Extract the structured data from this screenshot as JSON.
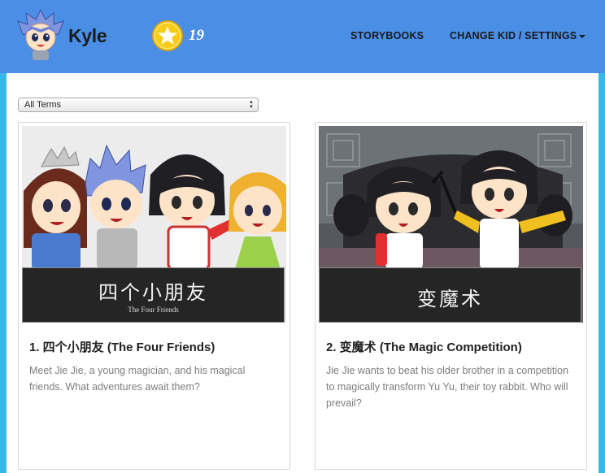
{
  "header": {
    "kid_name": "Kyle",
    "coin_count": "19",
    "nav": {
      "storybooks": "STORYBOOKS",
      "change_kid_settings": "CHANGE KID / SETTINGS"
    }
  },
  "filter": {
    "selected": "All Terms"
  },
  "stories": [
    {
      "title": "1. 四个小朋友 (The Four Friends)",
      "description": "Meet Jie Jie, a young magician, and his magical friends. What adventures await them?",
      "banner_title": "四个小朋友",
      "banner_subtitle": "The Four Friends"
    },
    {
      "title": "2. 变魔术 (The Magic Competition)",
      "description": "Jie Jie wants to beat his older brother in a competition to magically transform Yu Yu, their toy rabbit. Who will prevail?",
      "banner_title": "变魔术",
      "banner_subtitle": ""
    }
  ],
  "colors": {
    "header_bg": "#4a8ee6",
    "page_bg": "#38b8e8",
    "coin": "#f5c000"
  }
}
